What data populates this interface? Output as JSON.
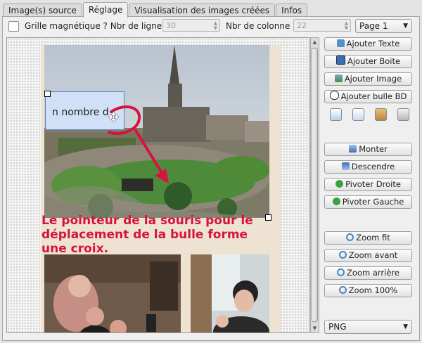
{
  "tabs": [
    "Image(s) source",
    "Réglage",
    "Visualisation des images créées",
    "Infos"
  ],
  "options": {
    "grid_label": "Grille magnétique ? Nbr de ligne :",
    "lines_value": "30",
    "columns_label": "Nbr de colonne :",
    "columns_value": "22",
    "page_select": "Page 1",
    "format_select": "PNG"
  },
  "canvas": {
    "bubble_text": "n nombre d",
    "annotation": "Le pointeur de la souris pour le déplacement de la bulle forme une croix."
  },
  "buttons": {
    "add_text": "Ajouter Texte",
    "add_box": "Ajouter Boite",
    "add_image": "Ajouter Image",
    "add_bubble": "Ajouter bulle BD",
    "raise": "Monter",
    "lower": "Descendre",
    "rotate_right": "Pivoter Droite",
    "rotate_left": "Pivoter Gauche",
    "zoom_fit": "Zoom fit",
    "zoom_in": "Zoom avant",
    "zoom_out": "Zoom arrière",
    "zoom_100": "Zoom 100%"
  },
  "icons": [
    "copy-icon",
    "cut-icon",
    "paste-icon",
    "delete-icon"
  ],
  "colors": {
    "annotation": "#d4143c",
    "canvas_page": "#eee2d2",
    "bubble": "#cfe0f7"
  }
}
